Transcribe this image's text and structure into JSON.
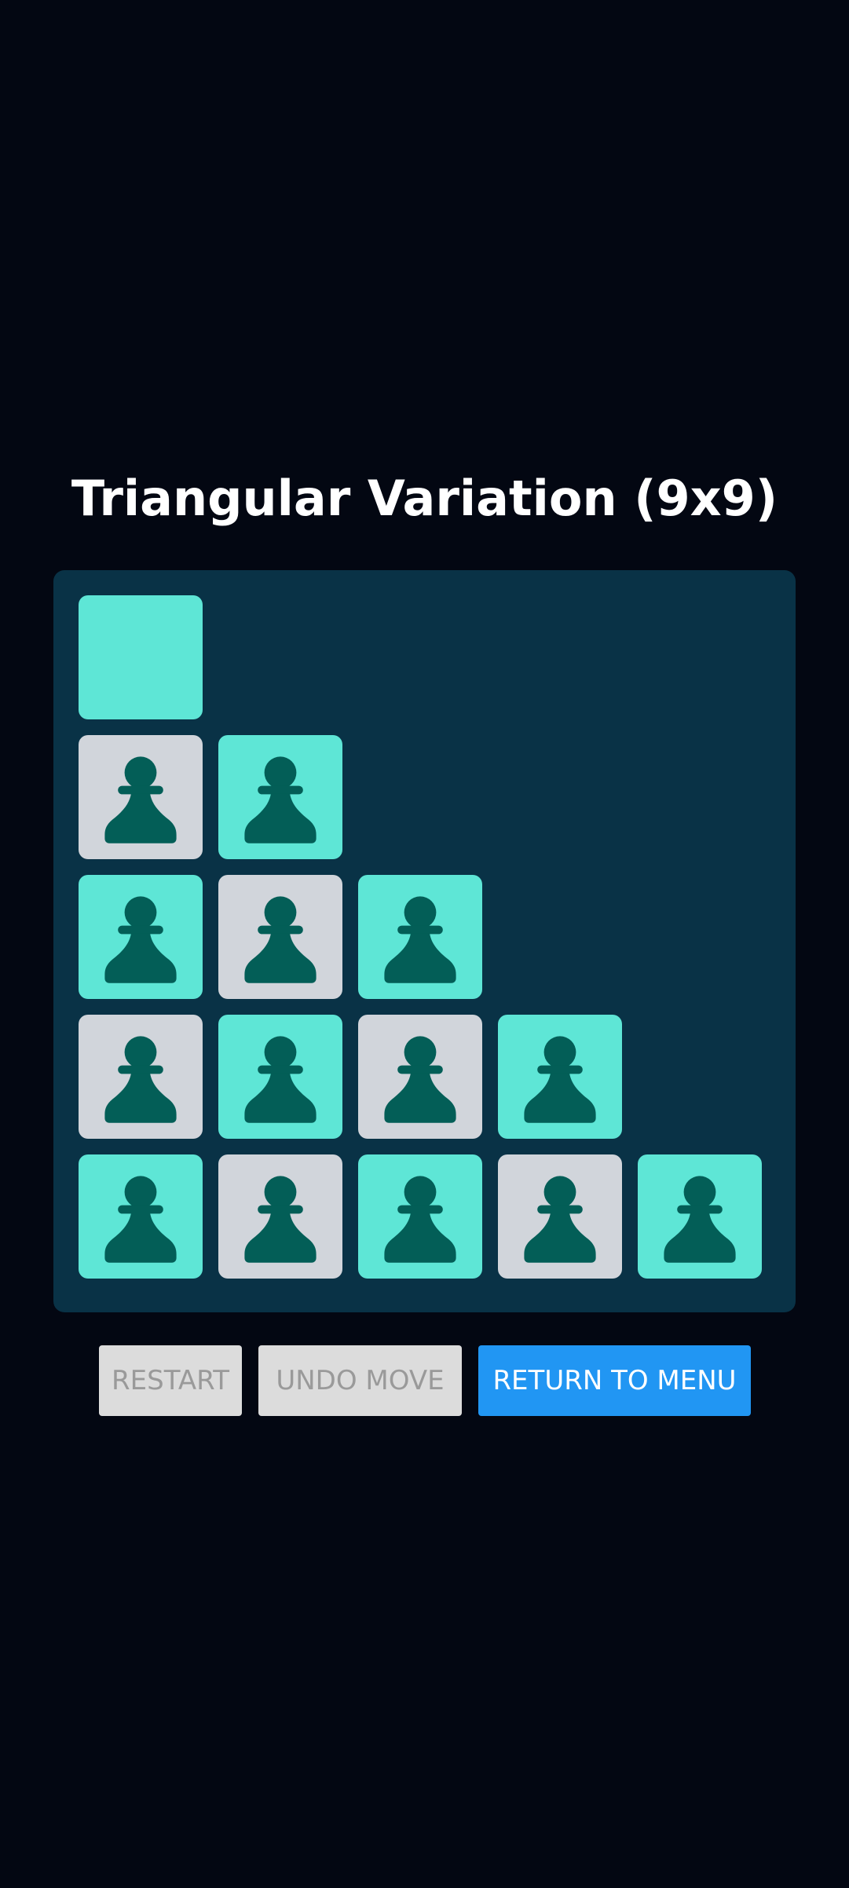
{
  "header": {
    "title": "Triangular Variation (9x9)"
  },
  "board": {
    "rows": [
      [
        {
          "color": "teal",
          "piece": false
        }
      ],
      [
        {
          "color": "gray",
          "piece": true
        },
        {
          "color": "teal",
          "piece": true
        }
      ],
      [
        {
          "color": "teal",
          "piece": true
        },
        {
          "color": "gray",
          "piece": true
        },
        {
          "color": "teal",
          "piece": true
        }
      ],
      [
        {
          "color": "gray",
          "piece": true
        },
        {
          "color": "teal",
          "piece": true
        },
        {
          "color": "gray",
          "piece": true
        },
        {
          "color": "teal",
          "piece": true
        }
      ],
      [
        {
          "color": "teal",
          "piece": true
        },
        {
          "color": "gray",
          "piece": true
        },
        {
          "color": "teal",
          "piece": true
        },
        {
          "color": "gray",
          "piece": true
        },
        {
          "color": "teal",
          "piece": true
        }
      ]
    ],
    "piece_icon": "pawn-icon",
    "colors": {
      "board_bg": "#093246",
      "teal_cell": "#5ee6d6",
      "gray_cell": "#d1d5db",
      "piece": "#035e57"
    }
  },
  "controls": {
    "restart_label": "RESTART",
    "undo_label": "UNDO MOVE",
    "menu_label": "RETURN TO MENU",
    "restart_disabled": true,
    "undo_disabled": true
  }
}
